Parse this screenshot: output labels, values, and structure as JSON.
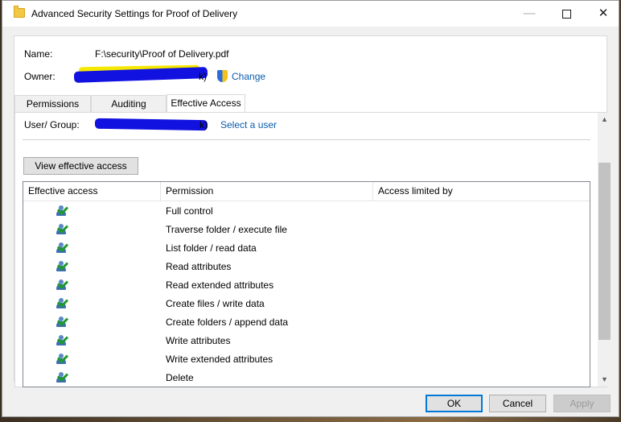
{
  "window": {
    "title": "Advanced Security Settings for Proof of Delivery",
    "minimize_glyph": "—",
    "close_glyph": "✕"
  },
  "info": {
    "name_label": "Name:",
    "name_value": "F:\\security\\Proof of Delivery.pdf",
    "owner_label": "Owner:",
    "owner_value_visible": "k)",
    "change_link": "Change"
  },
  "tabs": [
    {
      "label": "Permissions",
      "active": false
    },
    {
      "label": "Auditing",
      "active": false
    },
    {
      "label": "Effective Access",
      "active": true
    }
  ],
  "effective_access": {
    "user_group_label": "User/ Group:",
    "user_group_value_visible": "k)",
    "select_user_link": "Select a user",
    "view_button": "View effective access",
    "columns": [
      "Effective access",
      "Permission",
      "Access limited by"
    ],
    "rows": [
      {
        "icon": "user-check-icon",
        "permission": "Full control",
        "limited_by": ""
      },
      {
        "icon": "user-check-icon",
        "permission": "Traverse folder / execute file",
        "limited_by": ""
      },
      {
        "icon": "user-check-icon",
        "permission": "List folder / read data",
        "limited_by": ""
      },
      {
        "icon": "user-check-icon",
        "permission": "Read attributes",
        "limited_by": ""
      },
      {
        "icon": "user-check-icon",
        "permission": "Read extended attributes",
        "limited_by": ""
      },
      {
        "icon": "user-check-icon",
        "permission": "Create files / write data",
        "limited_by": ""
      },
      {
        "icon": "user-check-icon",
        "permission": "Create folders / append data",
        "limited_by": ""
      },
      {
        "icon": "user-check-icon",
        "permission": "Write attributes",
        "limited_by": ""
      },
      {
        "icon": "user-check-icon",
        "permission": "Write extended attributes",
        "limited_by": ""
      },
      {
        "icon": "user-check-icon",
        "permission": "Delete",
        "limited_by": ""
      }
    ]
  },
  "footer": {
    "ok": "OK",
    "cancel": "Cancel",
    "apply": "Apply"
  },
  "colors": {
    "link": "#0b5cad",
    "redaction_blue": "#1212e0",
    "redaction_yellow": "#f5e800",
    "focus_border": "#0078d7"
  }
}
